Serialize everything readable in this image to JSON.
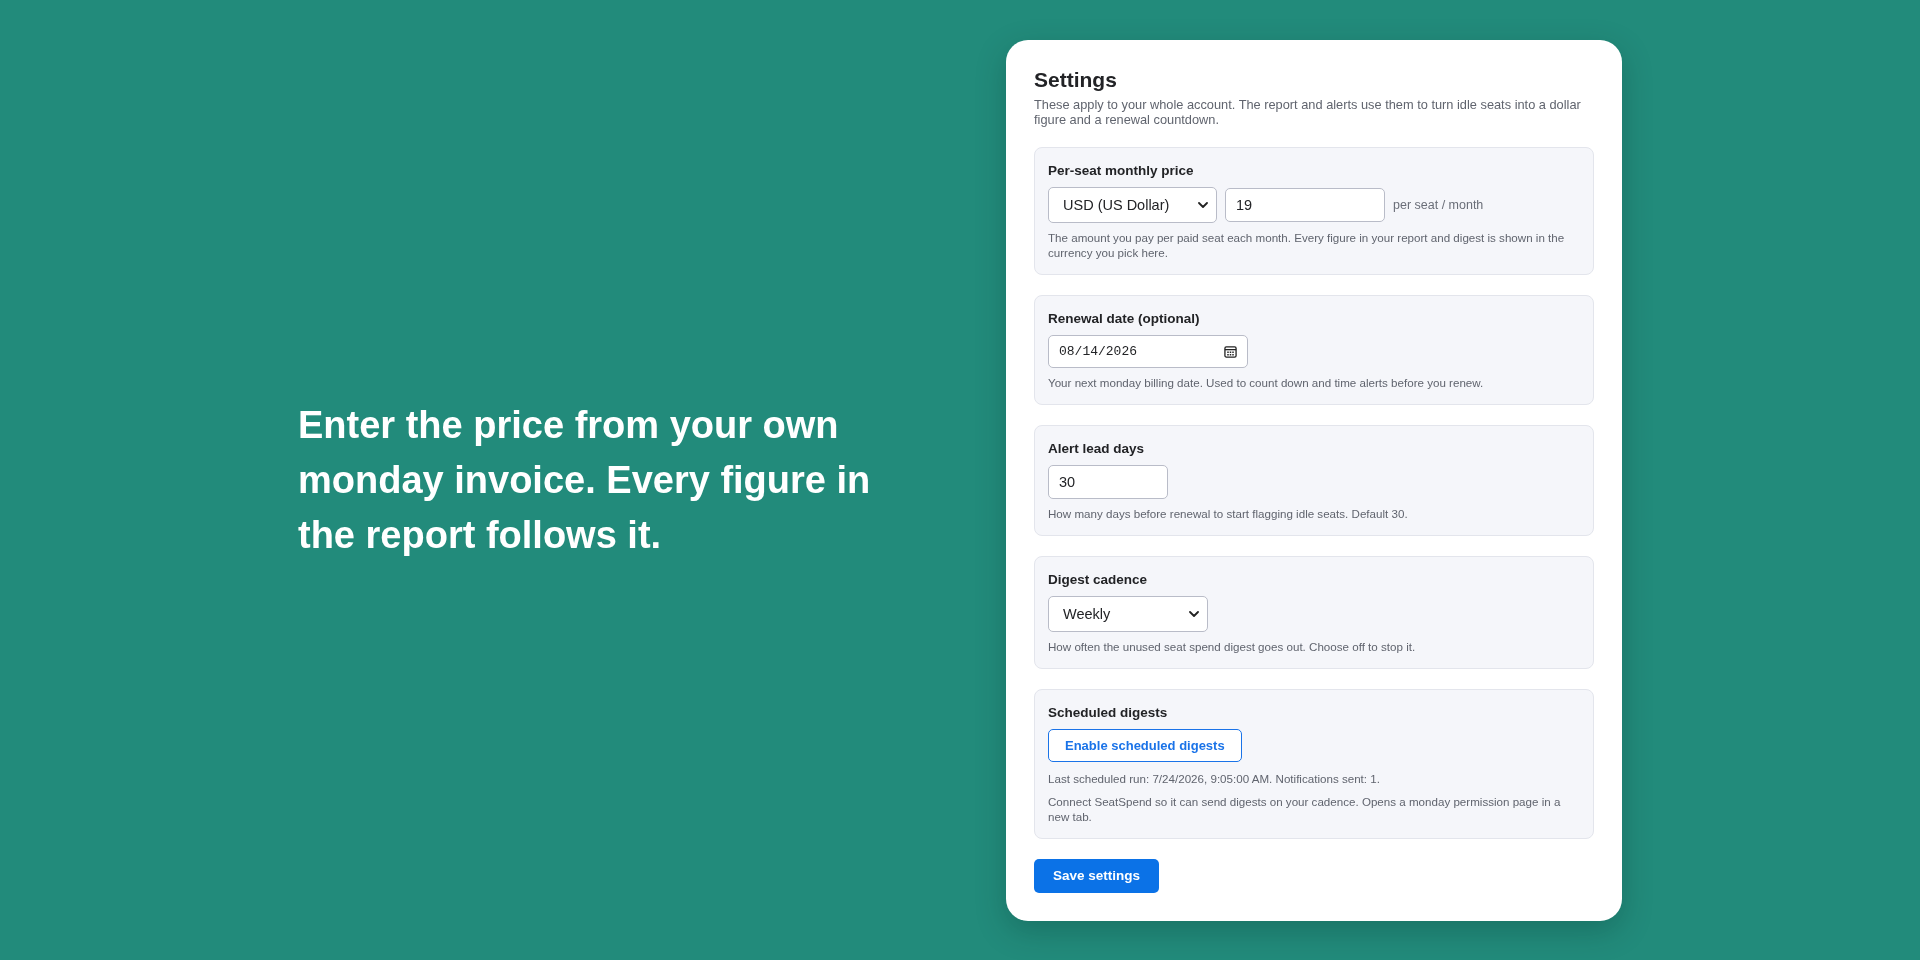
{
  "hero": {
    "text": "Enter the price from your own monday invoice. Every figure in the report follows it."
  },
  "settings": {
    "title": "Settings",
    "description": "These apply to your whole account. The report and alerts use them to turn idle seats into a dollar figure and a renewal countdown.",
    "sections": [
      {
        "kind": "price",
        "label": "Per-seat monthly price",
        "currency": "USD (US Dollar)",
        "amount": "19",
        "unit": "per seat / month",
        "notes": [
          "The amount you pay per paid seat each month. Every figure in your report and digest is shown in the currency you pick here."
        ]
      },
      {
        "kind": "date",
        "label": "Renewal date (optional)",
        "value": "08/14/2026",
        "notes": [
          "Your next monday billing date. Used to count down and time alerts before you renew."
        ]
      },
      {
        "kind": "number",
        "label": "Alert lead days",
        "value": "30",
        "notes": [
          "How many days before renewal to start flagging idle seats. Default 30."
        ]
      },
      {
        "kind": "choice",
        "label": "Digest cadence",
        "value": "Weekly",
        "notes": [
          "How often the unused seat spend digest goes out. Choose off to stop it."
        ]
      },
      {
        "kind": "action",
        "label": "Scheduled digests",
        "button": "Enable scheduled digests",
        "notes": [
          "Last scheduled run: 7/24/2026, 9:05:00 AM. Notifications sent: 1.",
          "Connect SeatSpend so it can send digests on your cadence. Opens a monday permission page in a new tab."
        ]
      }
    ],
    "save_button": "Save settings"
  }
}
